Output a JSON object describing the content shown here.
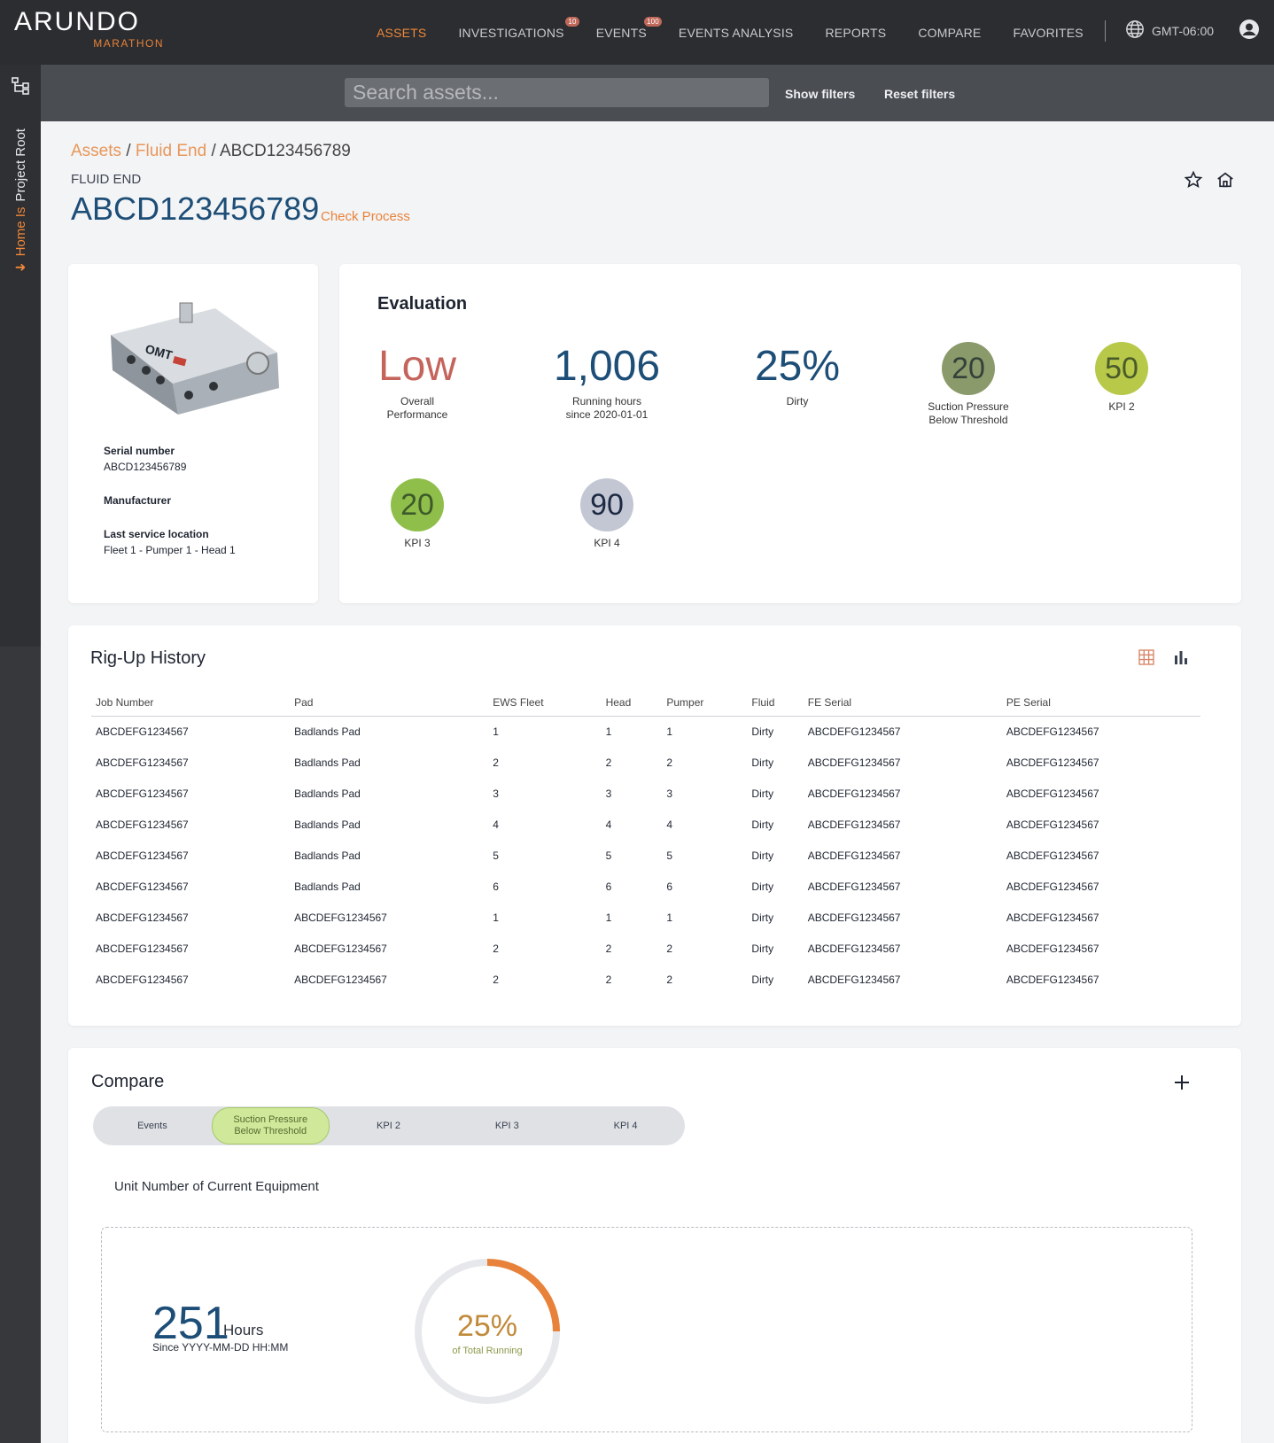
{
  "app": {
    "brand": "ARUNDO",
    "sub_brand": "MARATHON"
  },
  "nav": {
    "items": [
      {
        "label": "ASSETS",
        "badge": null
      },
      {
        "label": "INVESTIGATIONS",
        "badge": "10"
      },
      {
        "label": "EVENTS",
        "badge": "100"
      },
      {
        "label": "EVENTS ANALYSIS",
        "badge": null
      },
      {
        "label": "REPORTS",
        "badge": null
      },
      {
        "label": "COMPARE",
        "badge": null
      },
      {
        "label": "FAVORITES",
        "badge": null
      }
    ],
    "active": "ASSETS",
    "timezone": "GMT-06:00"
  },
  "rail": {
    "home_label": "Home Is",
    "project_label": "Project Root"
  },
  "search": {
    "placeholder": "Search assets...",
    "show_filters": "Show filters",
    "reset_filters": "Reset filters"
  },
  "header": {
    "breadcrumb": [
      "Assets",
      "Fluid End",
      "ABCD123456789"
    ],
    "asset_type": "FLUID END",
    "title": "ABCD123456789",
    "check_process": "Check Process"
  },
  "asset": {
    "image_label": "OMT",
    "serial_label": "Serial number",
    "serial_value": "ABCD123456789",
    "manufacturer_label": "Manufacturer",
    "location_label": "Last service location",
    "location_value": "Fleet 1 - Pumper 1 - Head 1"
  },
  "evaluation": {
    "title": "Evaluation",
    "kpis": [
      {
        "value": "Low",
        "label": "Overall\nPerformance",
        "color": "#c5645c"
      },
      {
        "value": "1,006",
        "label": "Running hours\nsince 2020-01-01",
        "color": "#1d4e77"
      },
      {
        "value": "25%",
        "label": "Dirty",
        "color": "#1d4e77"
      },
      {
        "value": "20",
        "label": "Suction Pressure\nBelow Threshold",
        "color": "#8a9a6a"
      },
      {
        "value": "50",
        "label": "KPI 2",
        "color": "#b8c94a"
      },
      {
        "value": "20",
        "label": "KPI 3",
        "color": "#8fbf4a"
      },
      {
        "value": "90",
        "label": "KPI 4",
        "color": "#5a6b8c"
      }
    ]
  },
  "rig_up": {
    "title": "Rig-Up History",
    "columns": [
      "Job Number",
      "Pad",
      "EWS Fleet",
      "Head",
      "Pumper",
      "Fluid",
      "FE Serial",
      "PE Serial"
    ],
    "rows": [
      [
        "ABCDEFG1234567",
        "Badlands Pad",
        "1",
        "1",
        "1",
        "Dirty",
        "ABCDEFG1234567",
        "ABCDEFG1234567"
      ],
      [
        "ABCDEFG1234567",
        "Badlands Pad",
        "2",
        "2",
        "2",
        "Dirty",
        "ABCDEFG1234567",
        "ABCDEFG1234567"
      ],
      [
        "ABCDEFG1234567",
        "Badlands Pad",
        "3",
        "3",
        "3",
        "Dirty",
        "ABCDEFG1234567",
        "ABCDEFG1234567"
      ],
      [
        "ABCDEFG1234567",
        "Badlands Pad",
        "4",
        "4",
        "4",
        "Dirty",
        "ABCDEFG1234567",
        "ABCDEFG1234567"
      ],
      [
        "ABCDEFG1234567",
        "Badlands Pad",
        "5",
        "5",
        "5",
        "Dirty",
        "ABCDEFG1234567",
        "ABCDEFG1234567"
      ],
      [
        "ABCDEFG1234567",
        "Badlands Pad",
        "6",
        "6",
        "6",
        "Dirty",
        "ABCDEFG1234567",
        "ABCDEFG1234567"
      ],
      [
        "ABCDEFG1234567",
        "ABCDEFG1234567",
        "1",
        "1",
        "1",
        "Dirty",
        "ABCDEFG1234567",
        "ABCDEFG1234567"
      ],
      [
        "ABCDEFG1234567",
        "ABCDEFG1234567",
        "2",
        "2",
        "2",
        "Dirty",
        "ABCDEFG1234567",
        "ABCDEFG1234567"
      ],
      [
        "ABCDEFG1234567",
        "ABCDEFG1234567",
        "2",
        "2",
        "2",
        "Dirty",
        "ABCDEFG1234567",
        "ABCDEFG1234567"
      ]
    ]
  },
  "compare": {
    "title": "Compare",
    "tabs": [
      "Events",
      "Suction Pressure\nBelow Threshold",
      "KPI 2",
      "KPI 3",
      "KPI 4"
    ],
    "active_tab": 1,
    "unit_label": "Unit Number of Current Equipment",
    "hours_value": "251",
    "hours_unit": "Hours",
    "hours_since": "Since YYYY-MM-DD HH:MM",
    "percent_value": "25%",
    "percent_label": "of Total Running",
    "percent_fraction": 0.25
  },
  "colors": {
    "accent": "#f0873a",
    "title_blue": "#1d4e77"
  }
}
